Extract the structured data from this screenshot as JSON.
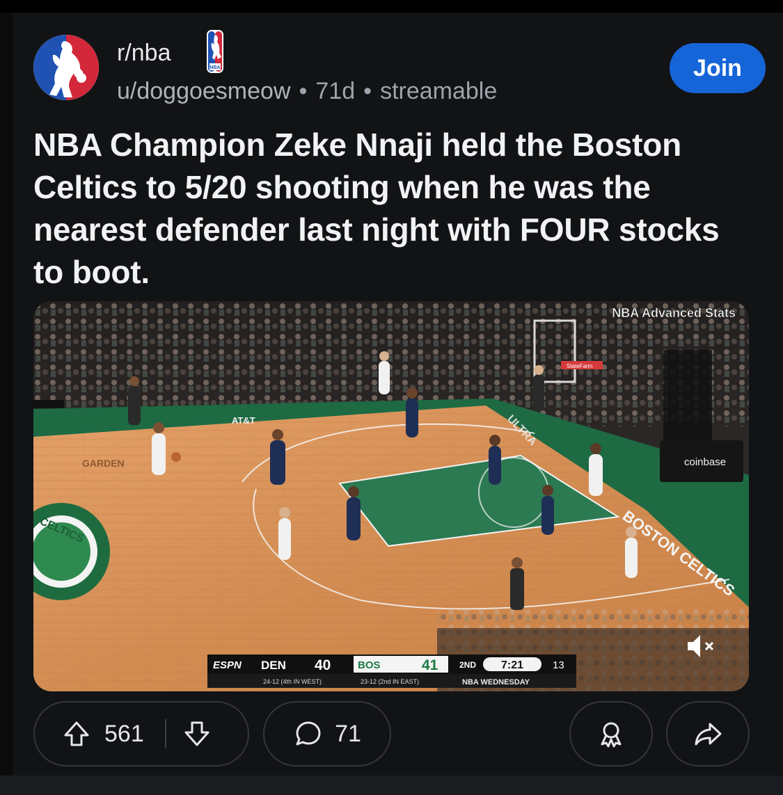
{
  "post": {
    "subreddit": "r/nba",
    "user": "u/doggoesmeow",
    "age": "71d",
    "source": "streamable",
    "join_label": "Join",
    "title": "NBA Champion Zeke Nnaji held the Boston Celtics to 5/20 shooting when he was the nearest defender last night with FOUR stocks to boot."
  },
  "media": {
    "overlay_label": "NBA Advanced Stats",
    "court_text": [
      "AT&T",
      "GARDEN",
      "BOSTON CELTICS",
      "coinbase",
      "ULTRA",
      "CELTICS",
      "StateFarm"
    ],
    "scorebug": {
      "network": "ESPN",
      "away_team": "DEN",
      "away_score": "40",
      "home_team": "BOS",
      "home_score": "41",
      "period": "2ND",
      "clock": "7:21",
      "shot_clock": "13",
      "away_record": "24-12 (4th IN WEST)",
      "home_record": "23-12 (2nd IN EAST)",
      "footer": "NBA WEDNESDAY"
    },
    "muted_icon": "speaker-muted-icon"
  },
  "actions": {
    "upvotes": "561",
    "comments": "71",
    "icons": [
      "upvote-icon",
      "downvote-icon",
      "comment-icon",
      "award-icon",
      "share-icon"
    ]
  },
  "colors": {
    "background": "#121315",
    "join_button": "#1665d8",
    "title_text": "#f1f2f4",
    "meta_text": "#9ea3ab"
  }
}
